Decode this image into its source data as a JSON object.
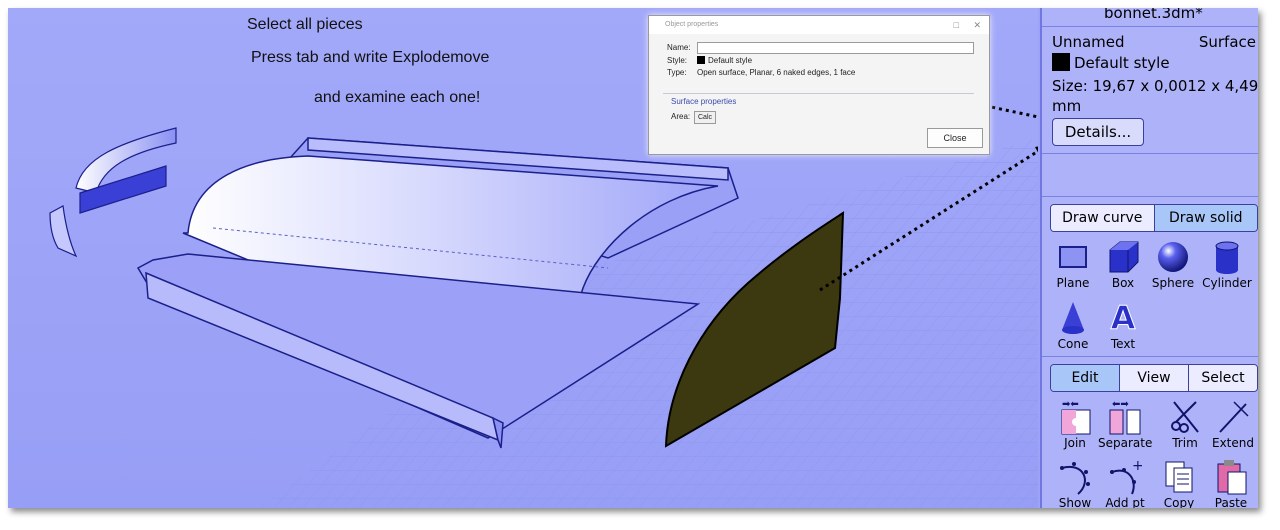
{
  "instructions": {
    "line1": "Select all pieces",
    "line2": "Press tab and write Explodemove",
    "line3": "and examine each one!"
  },
  "dialog": {
    "title": "Object properties",
    "name_label": "Name:",
    "name_value": "",
    "style_label": "Style:",
    "style_value": "Default style",
    "type_label": "Type:",
    "type_value": "Open surface, Planar, 6 naked edges, 1 face",
    "group_title": "Surface properties",
    "area_label": "Area:",
    "calc_button": "Calc",
    "close_button": "Close",
    "minimize": "□",
    "close_x": "✕"
  },
  "panel": {
    "filename": "bonnet.3dm*",
    "object_name": "Unnamed",
    "object_type": "Surface",
    "style": "Default style",
    "size": "Size: 19,67 x 0,0012 x 4,49",
    "size_unit": "mm",
    "details_button": "Details...",
    "draw_tabs": [
      {
        "label": "Draw curve",
        "active": false
      },
      {
        "label": "Draw solid",
        "active": true
      }
    ],
    "solid_tools": [
      {
        "label": "Plane",
        "icon": "plane-icon"
      },
      {
        "label": "Box",
        "icon": "box-icon"
      },
      {
        "label": "Sphere",
        "icon": "sphere-icon"
      },
      {
        "label": "Cylinder",
        "icon": "cylinder-icon"
      },
      {
        "label": "Cone",
        "icon": "cone-icon"
      },
      {
        "label": "Text",
        "icon": "text-icon"
      }
    ],
    "edit_tabs": [
      {
        "label": "Edit",
        "active": true
      },
      {
        "label": "View",
        "active": false
      },
      {
        "label": "Select",
        "active": false
      }
    ],
    "edit_tools": [
      {
        "label": "Join",
        "icon": "join-icon"
      },
      {
        "label": "Separate",
        "icon": "separate-icon"
      },
      {
        "label": "Trim",
        "icon": "trim-icon"
      },
      {
        "label": "Extend",
        "icon": "extend-icon"
      },
      {
        "label": "Show pts",
        "icon": "show-points-icon"
      },
      {
        "label": "Add pt",
        "icon": "add-point-icon"
      },
      {
        "label": "Copy",
        "icon": "copy-icon"
      },
      {
        "label": "Paste",
        "icon": "paste-icon"
      }
    ]
  },
  "colors": {
    "viewport_bg": "#a0a6f8",
    "panel_bg": "#aeb3f9",
    "selected_surface": "#3c3810",
    "accent": "#3b3f9e"
  }
}
